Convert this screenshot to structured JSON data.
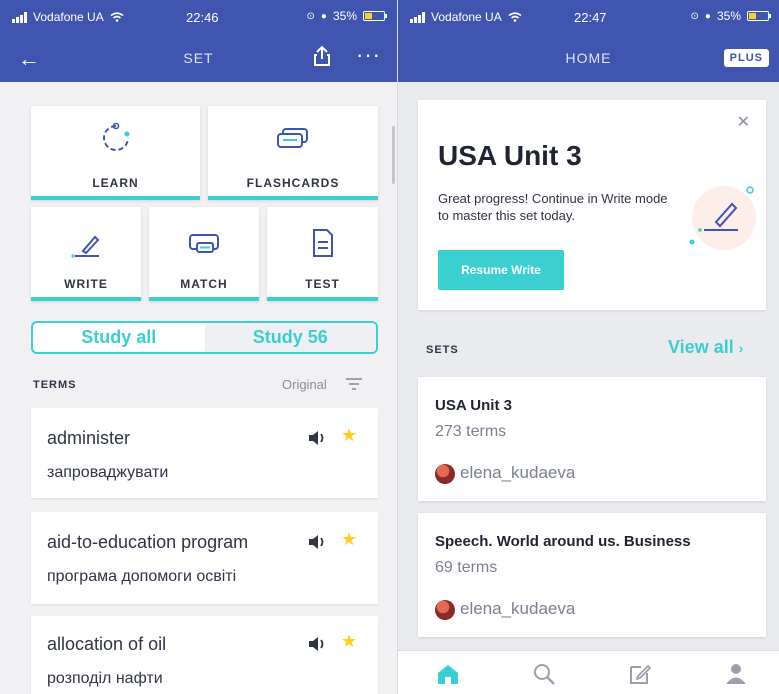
{
  "left": {
    "status": {
      "carrier": "Vodafone UA",
      "time": "22:46",
      "battery": "35%"
    },
    "nav": {
      "title": "SET"
    },
    "modes": [
      {
        "label": "LEARN",
        "icon": "learn-icon"
      },
      {
        "label": "FLASHCARDS",
        "icon": "flashcards-icon"
      },
      {
        "label": "WRITE",
        "icon": "write-icon"
      },
      {
        "label": "MATCH",
        "icon": "match-icon"
      },
      {
        "label": "TEST",
        "icon": "test-icon"
      }
    ],
    "toggle": {
      "study_all": "Study all",
      "study_56": "Study 56",
      "selected": "Study 56"
    },
    "terms_header": "TERMS",
    "sort_label": "Original",
    "terms": [
      {
        "word": "administer",
        "definition": "запроваджувати",
        "starred": true
      },
      {
        "word": "aid-to-education program",
        "definition": "програма допомоги освіті",
        "starred": true
      },
      {
        "word": "allocation of oil",
        "definition": "розподіл нафти",
        "starred": true
      }
    ]
  },
  "right": {
    "status": {
      "carrier": "Vodafone UA",
      "time": "22:47",
      "battery": "35%"
    },
    "nav": {
      "title": "HOME",
      "plus": "PLUS"
    },
    "continue_card": {
      "title": "USA Unit 3",
      "text": "Great progress! Continue in Write mode to master this set today.",
      "button": "Resume Write"
    },
    "sets_header": "SETS",
    "view_all": "View all",
    "sets": [
      {
        "title": "USA Unit 3",
        "count": "273 terms",
        "author": "elena_kudaeva"
      },
      {
        "title": "Speech. World around us. Business",
        "count": "69 terms",
        "author": "elena_kudaeva"
      }
    ]
  },
  "colors": {
    "brand": "#3f55b0",
    "accent": "#3ccfcf",
    "star": "#ffcd1f",
    "home_tab": "#3ccfcf"
  }
}
